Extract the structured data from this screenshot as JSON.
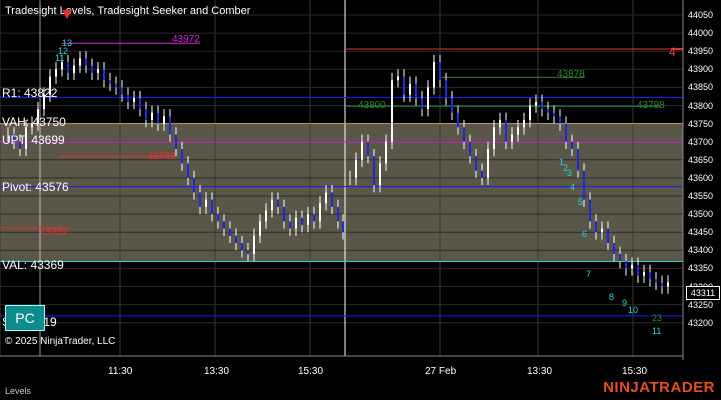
{
  "chart": {
    "title": "Tradesight Levels, Tradesight Seeker and Comber",
    "copyright": "© 2025 NinjaTrader, LLC",
    "brand": "NINJATRADER",
    "bottom_tab": "Levels",
    "pc_button": "PC",
    "last_price": "43311",
    "red_marker": "4"
  },
  "y_axis": [
    "44050",
    "44000",
    "43950",
    "43900",
    "43850",
    "43800",
    "43750",
    "43700",
    "43650",
    "43600",
    "43550",
    "43500",
    "43450",
    "43400",
    "43350",
    "43300",
    "43250",
    "43200"
  ],
  "x_axis": [
    "11:30",
    "13:30",
    "15:30",
    "27 Feb",
    "13:30",
    "15:30"
  ],
  "levels": {
    "r1": "R1: 43822",
    "vah": "VAH: 43750",
    "upt": "UPT: 43699",
    "pivot": "Pivot: 43576",
    "val": "VAL: 43369",
    "s1": "S1: 43219"
  },
  "markers": {
    "m43972": "43972",
    "m43878": "43878",
    "m43800": "43800",
    "m43798": "43798",
    "m43660": "43660",
    "m43462": "43462"
  },
  "sequence": {
    "s13": "13",
    "s12": "12",
    "s11": "11",
    "c1": "1",
    "c2": "2",
    "c3": "3",
    "c4": "4",
    "c5": "5",
    "c6": "6",
    "c7": "7",
    "c8": "8",
    "c9": "9",
    "c10": "10",
    "c11": "11",
    "c12": "12",
    "d23": "23"
  },
  "colors": {
    "background": "#000000",
    "value_area": "#5a5648",
    "blue_level": "#1a1aff",
    "cyan_level": "#2ad4d4",
    "magenta": "#e020e0",
    "red": "#e83030",
    "green": "#2a8a2a",
    "bar": "#ffffff",
    "bar_down": "#1e2ad8"
  }
}
